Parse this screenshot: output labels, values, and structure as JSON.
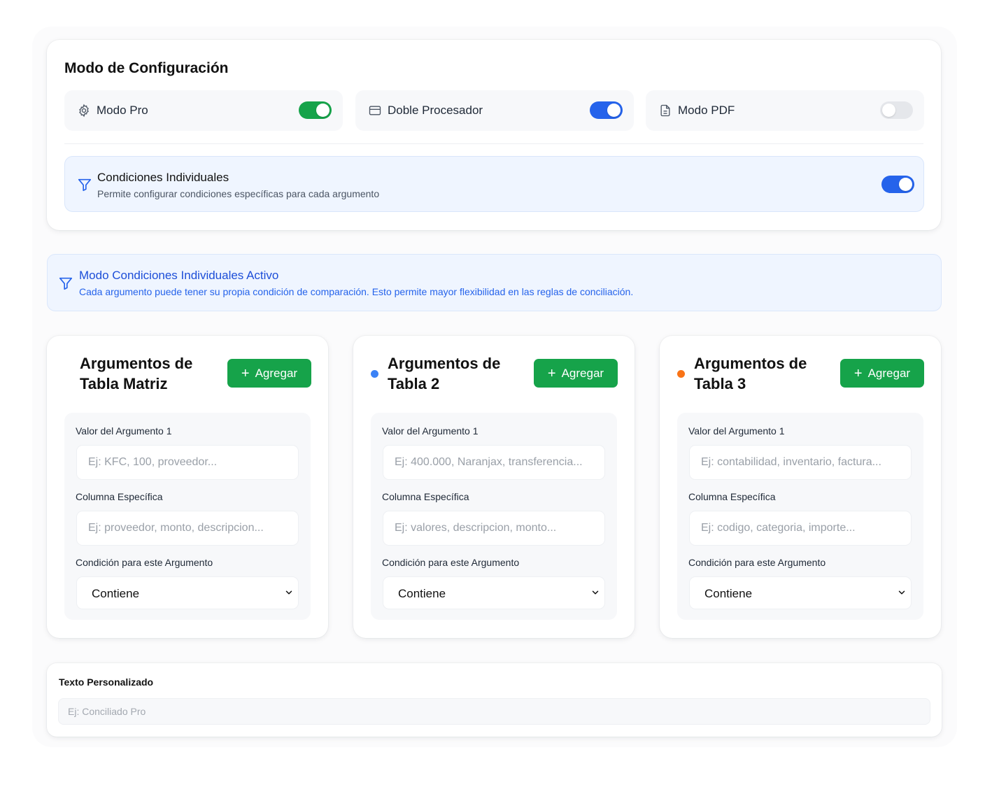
{
  "config": {
    "title": "Modo de Configuración",
    "modes": [
      {
        "label": "Modo Pro",
        "icon": "gear-icon",
        "enabled": true,
        "color": "#16a34a"
      },
      {
        "label": "Doble Procesador",
        "icon": "card-icon",
        "enabled": true,
        "color": "#2563eb"
      },
      {
        "label": "Modo PDF",
        "icon": "file-icon",
        "enabled": false,
        "color": "#e5e7eb"
      }
    ],
    "individual": {
      "title": "Condiciones Individuales",
      "subtitle": "Permite configurar condiciones específicas para cada argumento",
      "icon": "filter-icon",
      "enabled": true,
      "color": "#2563eb"
    }
  },
  "banner": {
    "title": "Modo Condiciones Individuales Activo",
    "subtitle": "Cada argumento puede tener su propia condición de comparación. Esto permite mayor flexibilidad en las reglas de conciliación.",
    "icon": "filter-icon"
  },
  "tables": [
    {
      "title_line1": "Argumentos de",
      "title_line2": "Tabla Matriz",
      "dot_color": "",
      "add_label": "Agregar",
      "value_label": "Valor del Argumento 1",
      "value_placeholder": "Ej: KFC, 100, proveedor...",
      "column_label": "Columna Específica",
      "column_placeholder": "Ej: proveedor, monto, descripcion...",
      "condition_label": "Condición para este Argumento",
      "condition_value": "Contiene"
    },
    {
      "title_line1": "Argumentos de",
      "title_line2": "Tabla 2",
      "dot_color": "#3b82f6",
      "add_label": "Agregar",
      "value_label": "Valor del Argumento 1",
      "value_placeholder": "Ej: 400.000, Naranjax, transferencia...",
      "column_label": "Columna Específica",
      "column_placeholder": "Ej: valores, descripcion, monto...",
      "condition_label": "Condición para este Argumento",
      "condition_value": "Contiene"
    },
    {
      "title_line1": "Argumentos de",
      "title_line2": "Tabla 3",
      "dot_color": "#f97316",
      "add_label": "Agregar",
      "value_label": "Valor del Argumento 1",
      "value_placeholder": "Ej: contabilidad, inventario, factura...",
      "column_label": "Columna Específica",
      "column_placeholder": "Ej: codigo, categoria, importe...",
      "condition_label": "Condición para este Argumento",
      "condition_value": "Contiene"
    }
  ],
  "custom_text": {
    "label": "Texto Personalizado",
    "placeholder": "Ej: Conciliado Pro"
  },
  "colors": {
    "accent_green": "#16a34a",
    "accent_blue": "#2563eb",
    "banner_bg": "#eff5ff"
  }
}
